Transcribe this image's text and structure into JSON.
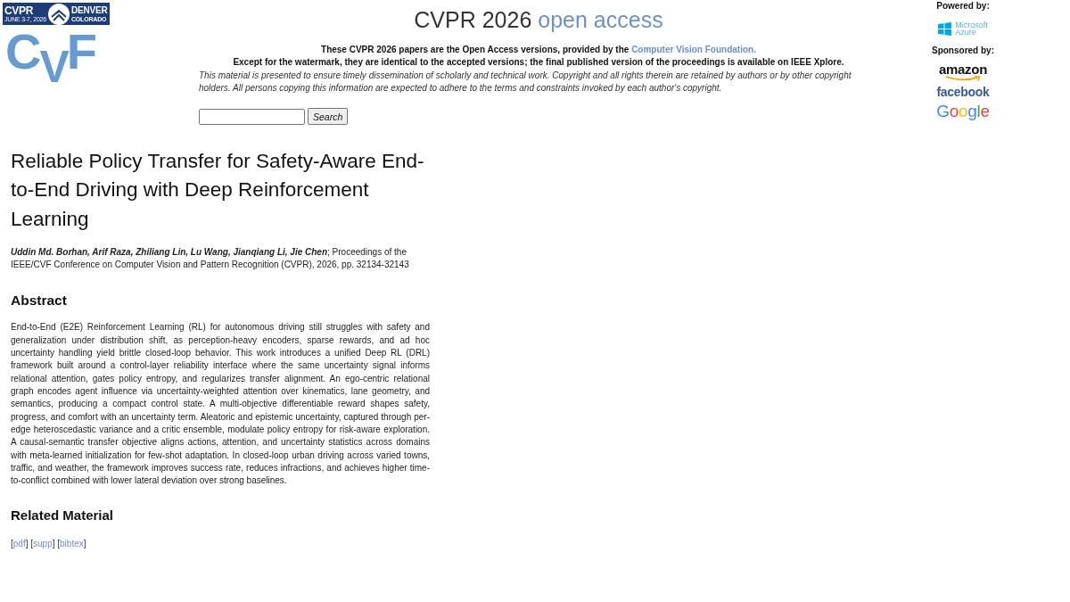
{
  "conference_badge": {
    "acronym": "CVPR",
    "dates": "JUNE 3-7, 2026",
    "city": "DENVER",
    "region": "COLORADO"
  },
  "cvf_logo": {
    "letters": "CVF"
  },
  "site_title": {
    "text": "CVPR 2026",
    "accent": "open access"
  },
  "notice": {
    "line_1": "These CVPR 2026 papers are the Open Access versions, provided by the ",
    "line_1_link": "Computer Vision Foundation.",
    "line_2": "Except for the watermark, they are identical to the accepted versions; the final published version of the proceedings is available on IEEE Xplore.",
    "disclaimer": "This material is presented to ensure timely dissemination of scholarly and technical work. Copyright and all rights therein are retained by authors or by other copyright holders. All persons copying this information are expected to adhere to the terms and constraints invoked by each author's copyright."
  },
  "search": {
    "button": "Search"
  },
  "sidebar": {
    "powered_by_label": "Powered by:",
    "azure_logo": {
      "line_1": "Microsoft",
      "line_2": "Azure"
    },
    "sponsored_by_label": "Sponsored by:",
    "sponsors": [
      {
        "kind": "amazon",
        "text": "amazon"
      },
      {
        "kind": "facebook",
        "text": "facebook"
      },
      {
        "kind": "google",
        "text": "Google"
      }
    ]
  },
  "paper": {
    "title": "Reliable Policy Transfer for Safety-Aware End-to-End Driving with Deep Reinforcement Learning",
    "authors": "Uddin Md. Borhan, Arif Raza, Zhiliang Lin, Lu Wang, Jianqiang Li, Jie Chen",
    "citation": "; Proceedings of the IEEE/CVF Conference on Computer Vision and Pattern Recognition (CVPR), 2026, pp. 32134-32143",
    "abstract_heading": "Abstract",
    "abstract": "End-to-End (E2E) Reinforcement Learning (RL) for autonomous driving still struggles with safety and generalization under distribution shift, as perception-heavy encoders, sparse rewards, and ad hoc uncertainty handling yield brittle closed-loop behavior. This work introduces a unified Deep RL (DRL) framework built around a control-layer reliability interface where the same uncertainty signal informs relational attention, gates policy entropy, and regularizes transfer alignment. An ego-centric relational graph encodes agent influence via uncertainty-weighted attention over kinematics, lane geometry, and semantics, producing a compact control state. A multi-objective differentiable reward shapes safety, progress, and comfort with an uncertainty term. Aleatoric and epistemic uncertainty, captured through per-edge heteroscedastic variance and a critic ensemble, modulate policy entropy for risk-aware exploration. A causal-semantic transfer objective aligns actions, attention, and uncertainty statistics across domains with meta-learned initialization for few-shot adaptation. In closed-loop urban driving across varied towns, traffic, and weather, the framework improves success rate, reduces infractions, and achieves higher time-to-conflict combined with lower lateral deviation over strong baselines.",
    "related_heading": "Related Material",
    "related_links": [
      {
        "prefix": "[",
        "label": "pdf",
        "suffix": "]"
      },
      {
        "prefix": "[",
        "label": "supp",
        "suffix": "]"
      },
      {
        "prefix": "[",
        "label": "bibtex",
        "suffix": "]"
      }
    ]
  }
}
